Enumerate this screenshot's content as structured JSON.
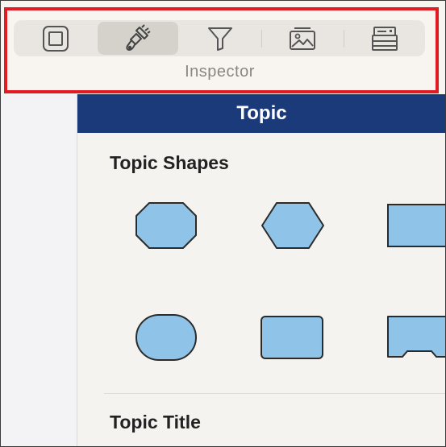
{
  "inspector": {
    "label": "Inspector",
    "tabs": [
      {
        "icon": "square-icon",
        "active": false
      },
      {
        "icon": "paintbrush-icon",
        "active": true
      },
      {
        "icon": "filter-icon",
        "active": false
      },
      {
        "icon": "image-icon",
        "active": false
      },
      {
        "icon": "archive-icon",
        "active": false
      }
    ]
  },
  "panel": {
    "header": "Topic",
    "shapes_title": "Topic Shapes",
    "title_section": "Topic Title",
    "shapes": [
      "octagon",
      "hexagon",
      "rectangle",
      "rounded-oval",
      "rounded-rectangle",
      "bottom-notched-rectangle"
    ]
  },
  "colors": {
    "header_bg": "#1b3a7a",
    "shape_fill": "#8fc3e8",
    "shape_stroke": "#2b2b2b",
    "highlight": "#e11a23"
  }
}
